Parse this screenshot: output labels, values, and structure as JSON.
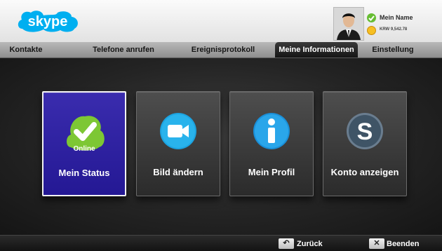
{
  "header": {
    "logo_text": "skype",
    "user": {
      "name": "Mein Name",
      "credit": "KRW 9,542.78"
    }
  },
  "tabs": [
    {
      "label": "Kontakte",
      "active": false
    },
    {
      "label": "Telefone anrufen",
      "active": false
    },
    {
      "label": "Ereignisprotokoll",
      "active": false
    },
    {
      "label": "Meine Informationen",
      "active": true
    },
    {
      "label": "Einstellung",
      "active": false
    }
  ],
  "tiles": [
    {
      "label": "Mein Status",
      "sublabel": "Online",
      "icon": "online-check-icon",
      "selected": true
    },
    {
      "label": "Bild ändern",
      "icon": "camera-icon",
      "selected": false
    },
    {
      "label": "Mein Profil",
      "icon": "info-icon",
      "selected": false
    },
    {
      "label": "Konto anzeigen",
      "icon": "skype-s-icon",
      "selected": false
    }
  ],
  "footer": {
    "back_label": "Zurück",
    "back_icon": "back-arrow-icon",
    "exit_label": "Beenden",
    "exit_icon": "close-x-icon"
  },
  "colors": {
    "skype_blue": "#00aff0",
    "selected_tile": "#2c1fa0",
    "status_green": "#67bd33",
    "credit_gold": "#f6bf22"
  }
}
